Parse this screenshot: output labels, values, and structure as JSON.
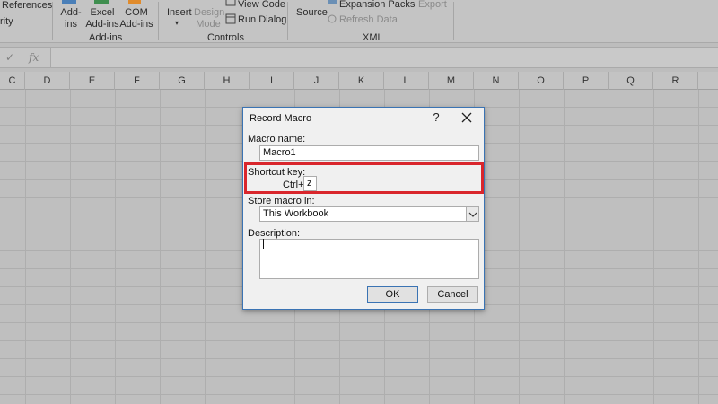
{
  "ribbon": {
    "references_label": "References",
    "rity_label": "rity",
    "addins_label_1": "Add-",
    "addins_label_2": "ins",
    "excel_addins_1": "Excel",
    "excel_addins_2": "Add-ins",
    "com_addins_1": "COM",
    "com_addins_2": "Add-ins",
    "group_addins": "Add-ins",
    "insert_label": "Insert",
    "design_mode_1": "Design",
    "design_mode_2": "Mode",
    "view_code": "View Code",
    "run_dialog": "Run Dialog",
    "group_controls": "Controls",
    "source_label": "Source",
    "expansion_packs": "Expansion Packs",
    "export_label": "Export",
    "refresh_data": "Refresh Data",
    "group_xml": "XML"
  },
  "formula_bar": {
    "cancel_glyph": "✓",
    "fx_label": "fx"
  },
  "columns": [
    "C",
    "D",
    "E",
    "F",
    "G",
    "H",
    "I",
    "J",
    "K",
    "L",
    "M",
    "N",
    "O",
    "P",
    "Q",
    "R"
  ],
  "dialog": {
    "title": "Record Macro",
    "help": "?",
    "macro_name_label": "Macro name:",
    "macro_name_value": "Macro1",
    "shortcut_label": "Shortcut key:",
    "ctrl_label": "Ctrl+",
    "shortcut_value": "z",
    "store_label": "Store macro in:",
    "store_value": "This Workbook",
    "description_label": "Description:",
    "ok_label": "OK",
    "cancel_label": "Cancel"
  },
  "colors": {
    "highlight_border": "#d9262c",
    "dialog_border": "#3a73b3"
  }
}
